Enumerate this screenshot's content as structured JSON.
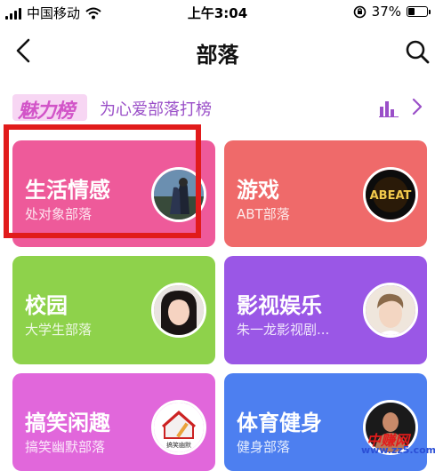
{
  "status_bar": {
    "carrier": "中国移动",
    "time": "上午3:04",
    "battery": "37%",
    "battery_level": 0.37
  },
  "nav": {
    "title": "部落"
  },
  "rank": {
    "logo_text": "魅力榜",
    "slogan": "为心爱部落打榜"
  },
  "cards": [
    {
      "title": "生活情感",
      "subtitle": "处对象部落",
      "color": "#ee5a9a"
    },
    {
      "title": "游戏",
      "subtitle": "ABT部落",
      "color": "#ef6a6a"
    },
    {
      "title": "校园",
      "subtitle": "大学生部落",
      "color": "#8ed24b"
    },
    {
      "title": "影视娱乐",
      "subtitle": "朱一龙影视剧...",
      "color": "#9a57e6"
    },
    {
      "title": "搞笑闲趣",
      "subtitle": "搞笑幽默部落",
      "color": "#e167db"
    },
    {
      "title": "体育健身",
      "subtitle": "健身部落",
      "color": "#4d7ff0"
    }
  ],
  "avatar_labels": {
    "game": "ABEAT",
    "funny": "搞笑幽默"
  },
  "watermark": {
    "main": "中赚网",
    "sub": "www.zz5.com"
  },
  "colors": {
    "highlight": "#e11b1b",
    "rank_purple": "#9a4fc8",
    "rank_pink": "#d254c8"
  }
}
